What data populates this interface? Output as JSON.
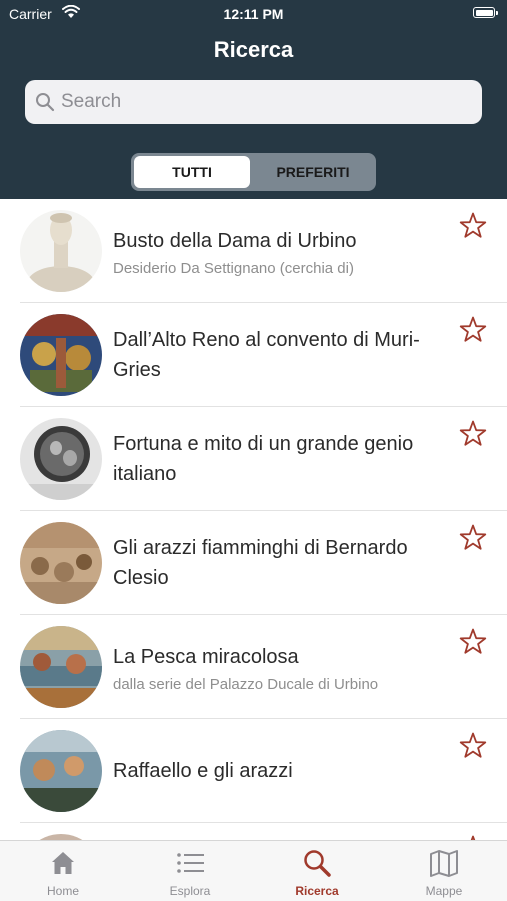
{
  "status_bar": {
    "carrier": "Carrier",
    "time": "12:11 PM"
  },
  "header": {
    "title": "Ricerca"
  },
  "search": {
    "placeholder": "Search",
    "value": ""
  },
  "segments": {
    "all": "TUTTI",
    "favorites": "PREFERITI",
    "selected": "TUTTI"
  },
  "results": [
    {
      "title": "Busto della Dama di Urbino",
      "subtitle": "Desiderio Da Settignano (cerchia di)"
    },
    {
      "title": "Dall’Alto Reno al convento di Muri-Gries",
      "subtitle": ""
    },
    {
      "title": "Fortuna e mito di un grande genio italiano",
      "subtitle": ""
    },
    {
      "title": "Gli arazzi fiamminghi di Bernardo Clesio",
      "subtitle": ""
    },
    {
      "title": "La Pesca miracolosa",
      "subtitle": "dalla serie del Palazzo Ducale di Urbino"
    },
    {
      "title": "Raffaello e gli arazzi",
      "subtitle": ""
    }
  ],
  "tabbar": {
    "items": [
      {
        "label": "Home",
        "icon": "house-icon"
      },
      {
        "label": "Esplora",
        "icon": "list-icon"
      },
      {
        "label": "Ricerca",
        "icon": "magnifier-icon"
      },
      {
        "label": "Mappe",
        "icon": "map-icon"
      }
    ],
    "active": "Ricerca"
  },
  "colors": {
    "header_bg": "#263844",
    "accent": "#a03a2c",
    "tab_inactive": "#8e8e93"
  }
}
